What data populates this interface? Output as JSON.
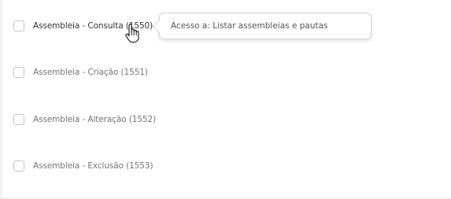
{
  "permissions": [
    {
      "label": "Assembleia - Consulta (1550)",
      "checked": false
    },
    {
      "label": "Assembleia - Criação (1551)",
      "checked": false
    },
    {
      "label": "Assembleia - Alteração (1552)",
      "checked": false
    },
    {
      "label": "Assembleia - Exclusão (1553)",
      "checked": false
    }
  ],
  "tooltip": {
    "text": "Acesso a: Listar assembleias e pautas"
  },
  "cursor": {
    "icon": "hand-pointer-icon"
  }
}
